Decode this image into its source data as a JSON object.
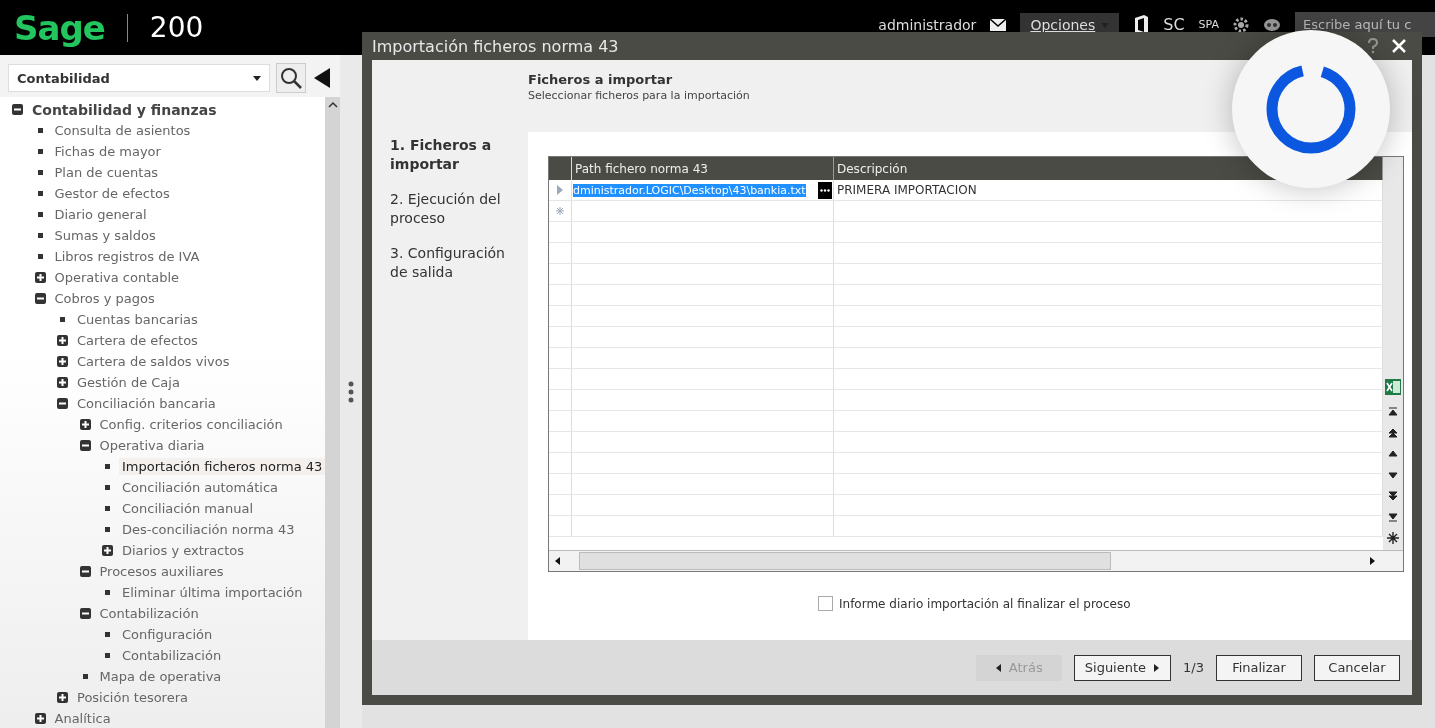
{
  "topbar": {
    "logo": "Sage",
    "product": "200",
    "user": "administrador",
    "options_menu": "Opciones",
    "company": "SC",
    "language": "SPA",
    "search": {
      "placeholder": "Escribe aquí tu c"
    }
  },
  "sidebar": {
    "module": "Contabilidad",
    "tree": [
      {
        "label": "Contabilidad y finanzas",
        "kind": "folder",
        "expanded": true,
        "selected": false,
        "children": [
          {
            "label": "Consulta de asientos",
            "kind": "leaf",
            "selected": false
          },
          {
            "label": "Fichas de mayor",
            "kind": "leaf",
            "selected": false
          },
          {
            "label": "Plan de cuentas",
            "kind": "leaf",
            "selected": false
          },
          {
            "label": "Gestor de efectos",
            "kind": "leaf",
            "selected": false
          },
          {
            "label": "Diario general",
            "kind": "leaf",
            "selected": false
          },
          {
            "label": "Sumas y saldos",
            "kind": "leaf",
            "selected": false
          },
          {
            "label": "Libros registros de IVA",
            "kind": "leaf",
            "selected": false
          },
          {
            "label": "Operativa contable",
            "kind": "folder",
            "expanded": false,
            "selected": false
          },
          {
            "label": "Cobros y pagos",
            "kind": "folder",
            "expanded": true,
            "selected": false,
            "children": [
              {
                "label": "Cuentas bancarias",
                "kind": "leaf",
                "selected": false
              },
              {
                "label": "Cartera de efectos",
                "kind": "folder",
                "expanded": false,
                "selected": false
              },
              {
                "label": "Cartera de saldos vivos",
                "kind": "folder",
                "expanded": false,
                "selected": false
              },
              {
                "label": "Gestión de Caja",
                "kind": "folder",
                "expanded": false,
                "selected": false
              },
              {
                "label": "Conciliación bancaria",
                "kind": "folder",
                "expanded": true,
                "selected": false,
                "children": [
                  {
                    "label": "Config. criterios conciliación",
                    "kind": "folder",
                    "expanded": false,
                    "selected": false
                  },
                  {
                    "label": "Operativa diaria",
                    "kind": "folder",
                    "expanded": true,
                    "selected": false,
                    "children": [
                      {
                        "label": "Importación ficheros norma 43",
                        "kind": "leaf",
                        "selected": true
                      },
                      {
                        "label": "Conciliación automática",
                        "kind": "leaf",
                        "selected": false
                      },
                      {
                        "label": "Conciliación manual",
                        "kind": "leaf",
                        "selected": false
                      },
                      {
                        "label": "Des-conciliación norma 43",
                        "kind": "leaf",
                        "selected": false
                      },
                      {
                        "label": "Diarios y extractos",
                        "kind": "folder",
                        "expanded": false,
                        "selected": false
                      }
                    ]
                  },
                  {
                    "label": "Procesos auxiliares",
                    "kind": "folder",
                    "expanded": true,
                    "selected": false,
                    "children": [
                      {
                        "label": "Eliminar última importación",
                        "kind": "leaf",
                        "selected": false
                      }
                    ]
                  },
                  {
                    "label": "Contabilización",
                    "kind": "folder",
                    "expanded": true,
                    "selected": false,
                    "children": [
                      {
                        "label": "Configuración",
                        "kind": "leaf",
                        "selected": false
                      },
                      {
                        "label": "Contabilización",
                        "kind": "leaf",
                        "selected": false
                      }
                    ]
                  },
                  {
                    "label": "Mapa de operativa",
                    "kind": "leaf",
                    "selected": false
                  }
                ]
              },
              {
                "label": "Posición tesorera",
                "kind": "folder",
                "expanded": false,
                "selected": false
              }
            ]
          },
          {
            "label": "Analítica",
            "kind": "folder",
            "expanded": false,
            "selected": false
          }
        ]
      }
    ]
  },
  "dialog": {
    "title": "Importación ficheros norma 43",
    "header": {
      "title": "Ficheros a importar",
      "subtitle": "Seleccionar ficheros para la importación"
    },
    "steps": [
      {
        "label": "1. Ficheros a importar",
        "selected": true
      },
      {
        "label": "2. Ejecución del proceso",
        "selected": false
      },
      {
        "label": "3. Configuración de salida",
        "selected": false
      }
    ],
    "table": {
      "columns": [
        "Path fichero norma 43",
        "Descripción"
      ],
      "rows": [
        {
          "cells": [
            "dministrador.LOGIC\\Desktop\\43\\bankia.txt",
            "PRIMERA IMPORTACION"
          ],
          "selected": true
        }
      ]
    },
    "option": {
      "label": "Informe diario importación al finalizar el proceso",
      "checked": false
    },
    "footer": {
      "back": {
        "label": "Atrás",
        "disabled": true
      },
      "next": {
        "label": "Siguiente",
        "disabled": false
      },
      "page": "1/3",
      "finish": {
        "label": "Finalizar",
        "disabled": false
      },
      "cancel": {
        "label": "Cancelar",
        "disabled": false
      }
    }
  }
}
